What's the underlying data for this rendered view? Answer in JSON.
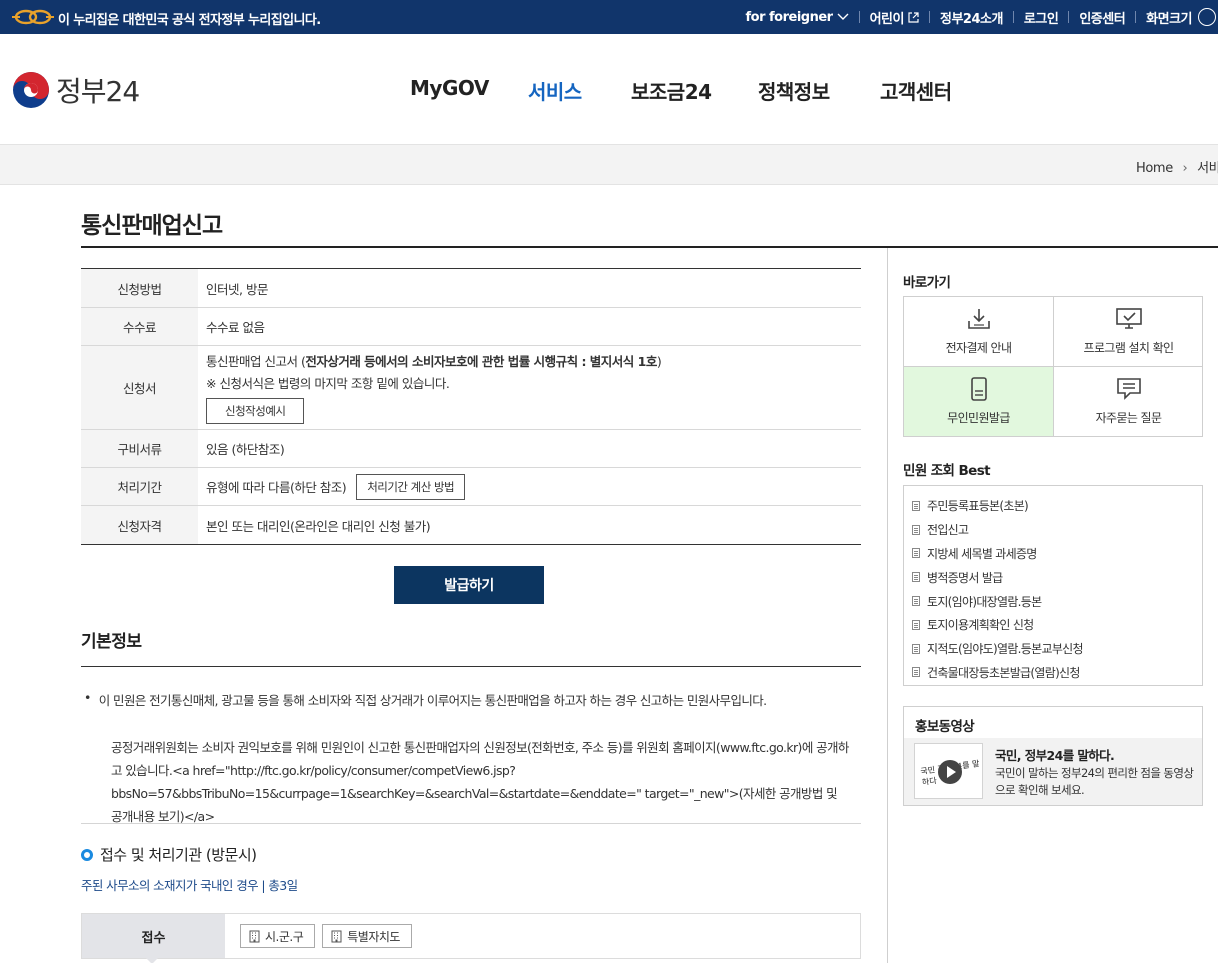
{
  "topbar": {
    "notice": "이 누리집은 대한민국 공식 전자정부 누리집입니다.",
    "links": [
      "for foreigner",
      "어린이",
      "정부24소개",
      "로그인",
      "인증센터",
      "화면크기"
    ]
  },
  "header": {
    "logo_text": "정부24",
    "nav": [
      "MyGOV",
      "서비스",
      "보조금24",
      "정책정보",
      "고객센터"
    ],
    "active_nav": "서비스"
  },
  "breadcrumb": {
    "home": "Home",
    "current": "서비스"
  },
  "page": {
    "title": "통신판매업신고",
    "info": {
      "method_label": "신청방법",
      "method_value": "인터넷, 방문",
      "fee_label": "수수료",
      "fee_value": "수수료 없음",
      "form_label": "신청서",
      "form_value_prefix": "통신판매업 신고서 (",
      "form_value_bold": "전자상거래 등에서의 소비자보호에 관한 법률 시행규칙 : 별지서식 1호",
      "form_value_suffix": ")",
      "form_note": "※ 신청서식은 법령의 마지막 조항 밑에 있습니다.",
      "form_example_button": "신청작성예시",
      "docs_label": "구비서류",
      "docs_value": "있음 (하단참조)",
      "period_label": "처리기간",
      "period_value": "유형에 따라 다름(하단 참조)",
      "period_button": "처리기간 계산 방법",
      "qual_label": "신청자격",
      "qual_value": "본인 또는 대리인(온라인은 대리인 신청 불가)"
    },
    "issue_button": "발급하기",
    "basic_info_title": "기본정보",
    "desc_bullet": "•",
    "desc1": "이 민원은 전기통신매체, 광고물 등을 통해 소비자와 직접 상거래가 이루어지는 통신판매업을 하고자 하는 경우 신고하는 민원사무입니다.",
    "desc2": "공정거래위원회는 소비자 권익보호를 위해 민원인이 신고한 통신판매업자의 신원정보(전화번호, 주소 등)를 위원회 홈페이지(www.ftc.go.kr)에 공개하고 있습니다.<a href=\"http://ftc.go.kr/policy/consumer/competView6.jsp?bbsNo=57&bbsTribuNo=15&currpage=1&searchKey=&searchVal=&startdate=&enddate=\" target=\"_new\">(자세한 공개방법 및 공개내용 보기)</a>",
    "reception_title": "접수 및 처리기관 (방문시)",
    "reception_sub": "주된 사무소의 소재지가 국내인 경우 | 총3일",
    "reception_label": "접수",
    "reception_options": [
      "시.군.구",
      "특별자치도"
    ]
  },
  "sidebar": {
    "shortcut_title": "바로가기",
    "shortcuts": [
      "전자결제 안내",
      "프로그램 설치 확인",
      "무인민원발급",
      "자주묻는 질문"
    ],
    "best_title": "민원 조회 Best",
    "best_items": [
      "주민등록표등본(초본)",
      "전입신고",
      "지방세 세목별 과세증명",
      "병적증명서 발급",
      "토지(임야)대장열람.등본",
      "토지이용계획확인 신청",
      "지적도(임야도)열람.등본교부신청",
      "건축물대장등초본발급(열람)신청"
    ],
    "promo_title": "홍보동영상",
    "promo_heading": "국민, 정부24를 말하다.",
    "promo_desc": "국민이 말하는 정부24의 편리한 점을 동영상으로 확인해 보세요."
  },
  "colors": {
    "topbar": "#11356b",
    "nav_active": "#1565c0",
    "issue_button": "#0c3560",
    "highlight": "#e2f8de"
  }
}
